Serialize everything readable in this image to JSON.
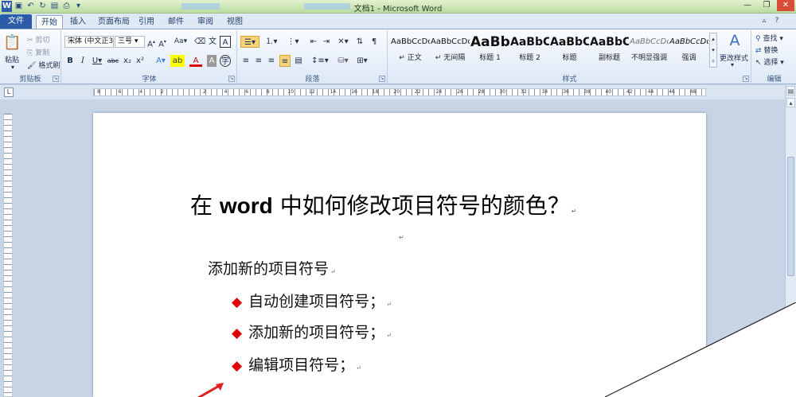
{
  "window": {
    "title": "文档1 - Microsoft Word",
    "blur_tabs": [
      "",
      ""
    ]
  },
  "tabs": [
    "文件",
    "开始",
    "插入",
    "页面布局",
    "引用",
    "邮件",
    "审阅",
    "视图"
  ],
  "ribbon": {
    "clipboard": {
      "label": "剪贴板",
      "paste": "粘贴",
      "cut": "剪切",
      "copy": "复制",
      "format_painter": "格式刷"
    },
    "font": {
      "label": "字体",
      "font_name": "宋体 (中文正3",
      "font_size": "三号"
    },
    "paragraph": {
      "label": "段落"
    },
    "styles": {
      "label": "样式",
      "items": [
        {
          "preview": "AaBbCcDd",
          "name": "↵ 正文"
        },
        {
          "preview": "AaBbCcDd",
          "name": "↵ 无间隔"
        },
        {
          "preview": "AaBb",
          "name": "标题 1"
        },
        {
          "preview": "AaBbC",
          "name": "标题 2"
        },
        {
          "preview": "AaBbC",
          "name": "标题"
        },
        {
          "preview": "AaBbC",
          "name": "副标题"
        },
        {
          "preview": "AaBbCcDd",
          "name": "不明显强调"
        },
        {
          "preview": "AaBbCcDd",
          "name": "强调"
        }
      ],
      "change_styles": "更改样式"
    },
    "editing": {
      "label": "编辑",
      "find": "查找",
      "replace": "替换",
      "select": "选择"
    }
  },
  "ruler": {
    "numbers": [
      "8",
      "6",
      "4",
      "2",
      "",
      "2",
      "4",
      "6",
      "8",
      "10",
      "12",
      "14",
      "16",
      "18",
      "20",
      "22",
      "24",
      "26",
      "28",
      "30",
      "32",
      "34",
      "36",
      "38",
      "40",
      "42",
      "44",
      "46",
      "48"
    ]
  },
  "document": {
    "title_pre": "在 ",
    "title_bold": "word",
    "title_post": " 中如何修改项目符号的颜色？",
    "para_mark": "↵",
    "heading": "添加新的项目符号",
    "list": [
      "自动创建项目符号；",
      "添加新的项目符号；",
      "编辑项目符号；"
    ]
  },
  "colors": {
    "bullet": "#e00000",
    "file_tab": "#2a5ca8",
    "arrow": "#e02020"
  }
}
